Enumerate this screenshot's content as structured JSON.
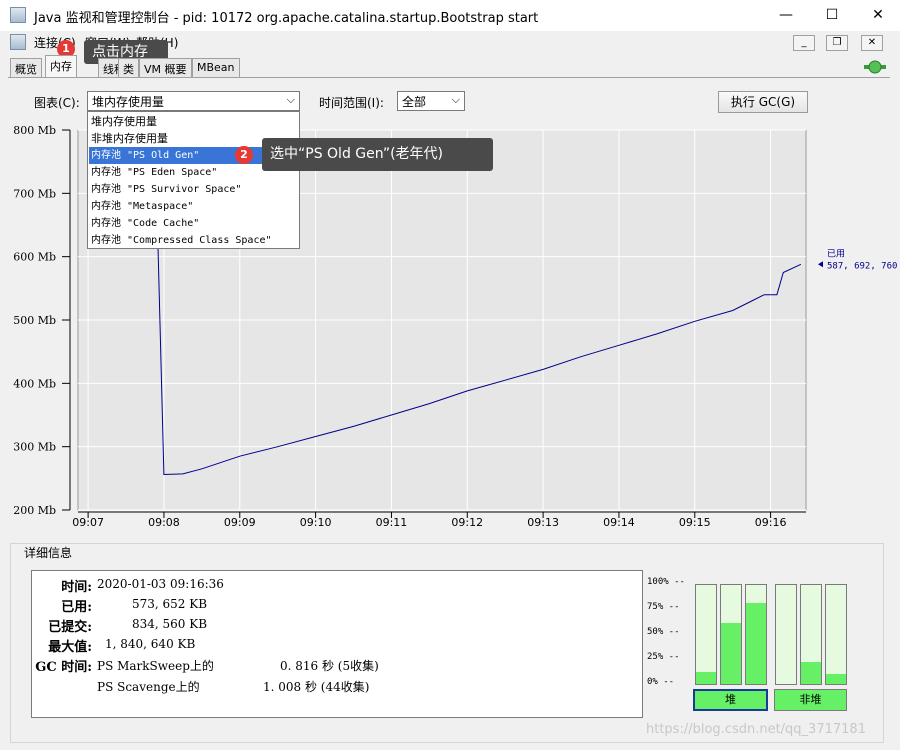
{
  "window": {
    "title": "Java 监视和管理控制台 - pid: 10172 org.apache.catalina.startup.Bootstrap start",
    "min_glyph": "—",
    "max_glyph": "☐",
    "close_glyph": "✕"
  },
  "menu": {
    "connect": "连接(C)",
    "window": "窗口(W)",
    "help": "帮助(H)"
  },
  "tabs": [
    "概览",
    "内存",
    "线程",
    "类",
    "VM 概要",
    "MBean"
  ],
  "active_tab": "内存",
  "controls": {
    "chart_label": "图表(C):",
    "chart_value": "堆内存使用量",
    "range_label": "时间范围(I):",
    "range_value": "全部",
    "gc_button": "执行 GC(G)"
  },
  "dropdown_options": [
    "堆内存使用量",
    "非堆内存使用量",
    "内存池 \"PS Old Gen\"",
    "内存池 \"PS Eden Space\"",
    "内存池 \"PS Survivor Space\"",
    "内存池 \"Metaspace\"",
    "内存池 \"Code Cache\"",
    "内存池 \"Compressed Class Space\""
  ],
  "dropdown_selected_index": 2,
  "annotations": [
    {
      "number": "1",
      "text": "点击内存"
    },
    {
      "number": "2",
      "text": "选中“PS Old Gen”(老年代)"
    }
  ],
  "chart_data": {
    "type": "line",
    "ylim": [
      200,
      800
    ],
    "y_ticks": [
      "200 Mb",
      "300 Mb",
      "400 Mb",
      "500 Mb",
      "600 Mb",
      "700 Mb",
      "800 Mb"
    ],
    "x_ticks": [
      "09:07",
      "09:08",
      "09:09",
      "09:10",
      "09:11",
      "09:12",
      "09:13",
      "09:14",
      "09:15",
      "09:16"
    ],
    "series": [
      {
        "name": "已用",
        "color": "#00008b",
        "x": [
          "09:07:05",
          "09:07:30",
          "09:07:55",
          "09:08:00",
          "09:08:15",
          "09:08:30",
          "09:09:00",
          "09:09:30",
          "09:10:00",
          "09:10:30",
          "09:11:00",
          "09:11:30",
          "09:12:00",
          "09:12:30",
          "09:13:00",
          "09:13:30",
          "09:14:00",
          "09:14:30",
          "09:15:00",
          "09:15:30",
          "09:15:45",
          "09:15:55",
          "09:16:05",
          "09:16:10",
          "09:16:24"
        ],
        "values": [
          666,
          700,
          640,
          256,
          257,
          265,
          285,
          300,
          316,
          332,
          350,
          368,
          388,
          405,
          422,
          442,
          460,
          478,
          498,
          515,
          530,
          540,
          540,
          575,
          588
        ]
      }
    ],
    "last_value_label": "已用",
    "last_value": "587, 692, 760"
  },
  "details": {
    "title": "详细信息",
    "rows": [
      {
        "key": "时间:",
        "value": "2020-01-03 09:16:36"
      },
      {
        "key": "已用:",
        "value": "573, 652 KB"
      },
      {
        "key": "已提交:",
        "value": "834, 560 KB"
      },
      {
        "key": "最大值:",
        "value": "1, 840, 640 KB"
      }
    ],
    "gc_key": "GC 时间:",
    "gc_rows": [
      {
        "collector": "PS MarkSweep上的",
        "time": "0. 816 秒 (5收集)"
      },
      {
        "collector": "PS Scavenge上的",
        "time": "1. 008 秒 (44收集)"
      }
    ]
  },
  "pool_bars": {
    "percent_labels": [
      "100% --",
      "75% --",
      "50% --",
      "25% --",
      "0% --"
    ],
    "heap_fill": [
      0.12,
      0.62,
      0.82
    ],
    "nonheap_fill": [
      0.0,
      0.22,
      0.1
    ],
    "heap_label": "堆",
    "nonheap_label": "非堆",
    "fill_color": "#66f066",
    "empty_color": "#e6fae0"
  },
  "watermark": "https://blog.csdn.net/qq_3717181"
}
